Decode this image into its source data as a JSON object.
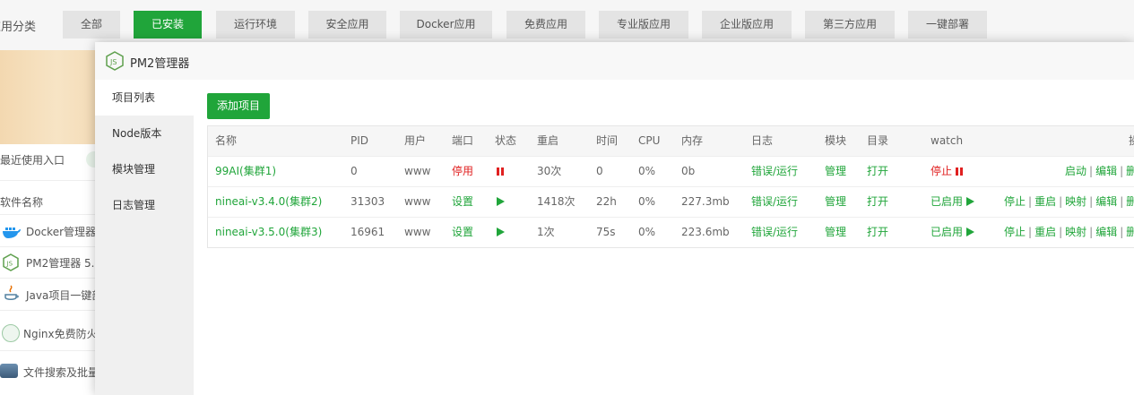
{
  "category_bar": {
    "label": "应用分类",
    "tabs": [
      {
        "label": "全部",
        "active": false
      },
      {
        "label": "已安装",
        "active": true
      },
      {
        "label": "运行环境",
        "active": false
      },
      {
        "label": "安全应用",
        "active": false
      },
      {
        "label": "Docker应用",
        "active": false
      },
      {
        "label": "免费应用",
        "active": false
      },
      {
        "label": "专业版应用",
        "active": false
      },
      {
        "label": "企业版应用",
        "active": false
      },
      {
        "label": "第三方应用",
        "active": false
      },
      {
        "label": "一键部署",
        "active": false
      }
    ]
  },
  "background_panel": {
    "recent_label": "最近使用入口",
    "software_header": "软件名称",
    "items": [
      {
        "label": "Docker管理器",
        "icon": "docker-icon"
      },
      {
        "label": "PM2管理器 5.",
        "icon": "nodejs-icon"
      },
      {
        "label": "Java项目一键部",
        "icon": "java-icon"
      },
      {
        "label": "Nginx免费防火",
        "icon": "waf-icon"
      },
      {
        "label": "文件搜索及批量",
        "icon": "file-search-icon"
      }
    ]
  },
  "dialog": {
    "title": "PM2管理器",
    "icon": "nodejs-icon",
    "nav": [
      {
        "label": "项目列表",
        "active": true
      },
      {
        "label": "Node版本",
        "active": false
      },
      {
        "label": "模块管理",
        "active": false
      },
      {
        "label": "日志管理",
        "active": false
      }
    ],
    "add_button": "添加项目",
    "table": {
      "headers": {
        "name": "名称",
        "pid": "PID",
        "user": "用户",
        "port": "端口",
        "status": "状态",
        "restart": "重启",
        "time": "时间",
        "cpu": "CPU",
        "mem": "内存",
        "log": "日志",
        "module": "模块",
        "dir": "目录",
        "watch": "watch",
        "op": "操"
      },
      "rows": [
        {
          "name": "99AI(集群1)",
          "pid": "0",
          "user": "www",
          "port": "停用",
          "port_color": "red",
          "status": "stopped",
          "restart": "30次",
          "time": "0",
          "cpu": "0%",
          "mem": "0b",
          "log": "错误/运行",
          "module": "管理",
          "dir": "打开",
          "watch": "停止",
          "watch_state": "stopped",
          "ops": [
            "启动",
            "编辑",
            "删"
          ]
        },
        {
          "name": "nineai-v3.4.0(集群2)",
          "pid": "31303",
          "user": "www",
          "port": "设置",
          "port_color": "green",
          "status": "running",
          "restart": "1418次",
          "time": "22h",
          "cpu": "0%",
          "mem": "227.3mb",
          "log": "错误/运行",
          "module": "管理",
          "dir": "打开",
          "watch": "已启用",
          "watch_state": "running",
          "ops": [
            "停止",
            "重启",
            "映射",
            "编辑",
            "删"
          ]
        },
        {
          "name": "nineai-v3.5.0(集群3)",
          "pid": "16961",
          "user": "www",
          "port": "设置",
          "port_color": "green",
          "status": "running",
          "restart": "1次",
          "time": "75s",
          "cpu": "0%",
          "mem": "223.6mb",
          "log": "错误/运行",
          "module": "管理",
          "dir": "打开",
          "watch": "已启用",
          "watch_state": "running",
          "ops": [
            "停止",
            "重启",
            "映射",
            "编辑",
            "删"
          ]
        }
      ]
    }
  },
  "colors": {
    "accent": "#20a53a",
    "danger": "#e02020"
  }
}
